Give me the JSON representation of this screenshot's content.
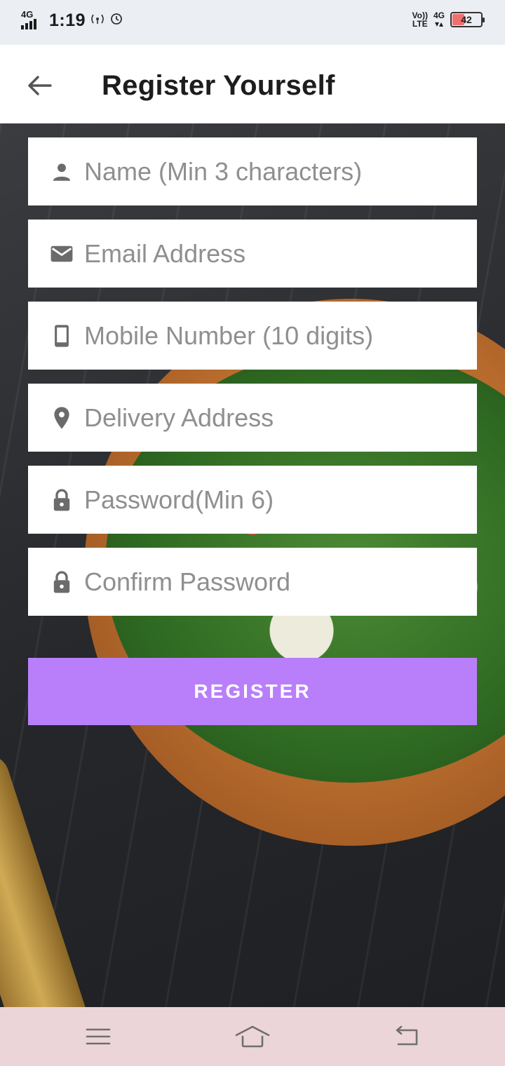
{
  "status_bar": {
    "network": "4G",
    "time": "1:19",
    "volte_line1": "Vo))",
    "volte_line2": "LTE",
    "data_net": "4G",
    "battery_level": "42",
    "battery_color": "#f07070"
  },
  "app_bar": {
    "title": "Register Yourself",
    "back_icon": "arrow-left-icon"
  },
  "form": {
    "fields": [
      {
        "icon": "person-icon",
        "placeholder": "Name (Min 3 characters)",
        "value": ""
      },
      {
        "icon": "email-icon",
        "placeholder": "Email Address",
        "value": ""
      },
      {
        "icon": "phone-icon",
        "placeholder": "Mobile Number (10 digits)",
        "value": ""
      },
      {
        "icon": "location-pin-icon",
        "placeholder": "Delivery Address",
        "value": ""
      },
      {
        "icon": "lock-icon",
        "placeholder": "Password(Min 6)",
        "value": ""
      },
      {
        "icon": "lock-icon",
        "placeholder": "Confirm Password",
        "value": ""
      }
    ],
    "submit_label": "REGISTER"
  },
  "nav_bar": {
    "menu_icon": "menu-icon",
    "home_icon": "home-icon",
    "back_icon": "back-icon"
  },
  "colors": {
    "accent": "#b97ffb",
    "appbar": "#ffffff",
    "navbar": "#ecd5d8",
    "statusbar": "#ebeef2"
  }
}
